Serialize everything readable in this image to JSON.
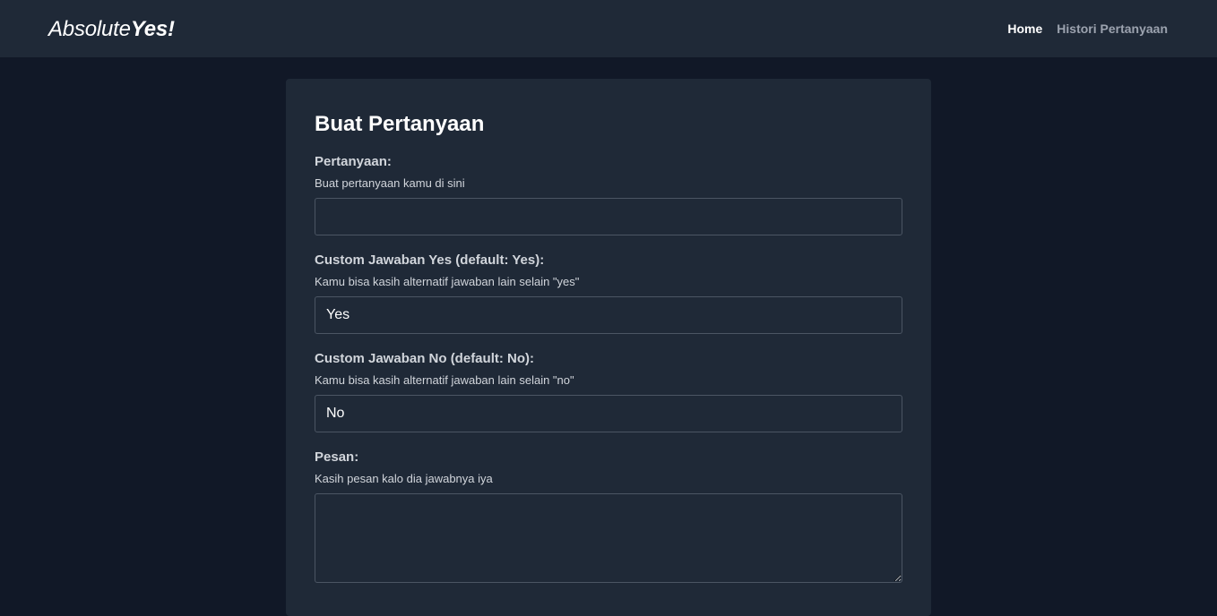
{
  "nav": {
    "brand_normal": "Absolute",
    "brand_bold": "Yes!",
    "links": {
      "home": "Home",
      "history": "Histori Pertanyaan"
    }
  },
  "form": {
    "title": "Buat Pertanyaan",
    "question": {
      "label": "Pertanyaan:",
      "help": "Buat pertanyaan kamu di sini",
      "value": ""
    },
    "yes_answer": {
      "label": "Custom Jawaban Yes (default: Yes):",
      "help": "Kamu bisa kasih alternatif jawaban lain selain \"yes\"",
      "value": "Yes"
    },
    "no_answer": {
      "label": "Custom Jawaban No (default: No):",
      "help": "Kamu bisa kasih alternatif jawaban lain selain \"no\"",
      "value": "No"
    },
    "message": {
      "label": "Pesan:",
      "help": "Kasih pesan kalo dia jawabnya iya",
      "value": ""
    }
  },
  "colors": {
    "page_background": "#111827",
    "panel_background": "#1f2937",
    "input_border": "#4b5563",
    "muted_text": "#9ca3af",
    "label_text": "#d1d5db"
  }
}
